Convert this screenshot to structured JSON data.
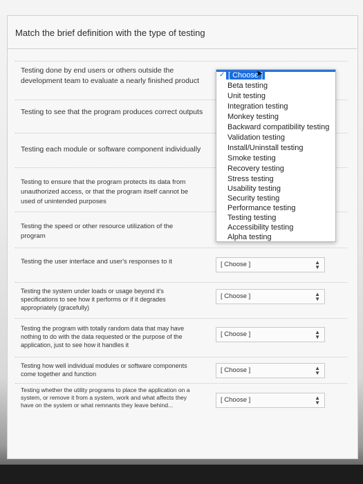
{
  "title": "Match the brief definition with the type of testing",
  "rows": [
    {
      "prompt": "Testing done by end users or others outside the development team to evaluate a nearly finished product"
    },
    {
      "prompt": "Testing to see that the program produces correct outputs"
    },
    {
      "prompt": "Testing each module or software component individually"
    },
    {
      "prompt": "Testing to ensure that the program protects its data from unauthorized access, or that the program itself cannot be used of unintended purposes"
    },
    {
      "prompt": "Testing the speed or other resource utilization of the program"
    },
    {
      "prompt": "Testing the user interface and user's responses to it",
      "select": "[ Choose ]"
    },
    {
      "prompt": "Testing the system under loads or usage beyond it's specifications to see how it performs or if it degrades appropriately (gracefully)",
      "select": "[ Choose ]"
    },
    {
      "prompt": "Testing the program with totally random data that may have nothing to do with the data requested or the purpose of the application, just to see how it handles it",
      "select": "[ Choose ]"
    },
    {
      "prompt": "Testing how well individual modules or software components come together and function",
      "select": "[ Choose ]"
    },
    {
      "prompt": "Testing whether the utility programs to place the application on a system, or remove it from a system, work and what affects they have on the system or what remnants they leave behind...",
      "select": "[ Choose ]"
    }
  ],
  "dropdown": {
    "options": [
      "[ Choose ]",
      "Beta testing",
      "Unit testing",
      "Integration testing",
      "Monkey testing",
      "Backward compatibility testing",
      "Validation testing",
      "Install/Uninstall testing",
      "Smoke testing",
      "Recovery testing",
      "Stress testing",
      "Usability testing",
      "Security testing",
      "Performance testing",
      "Testing testing",
      "Accessibility testing",
      "Alpha testing"
    ],
    "checkmark": "✓"
  }
}
